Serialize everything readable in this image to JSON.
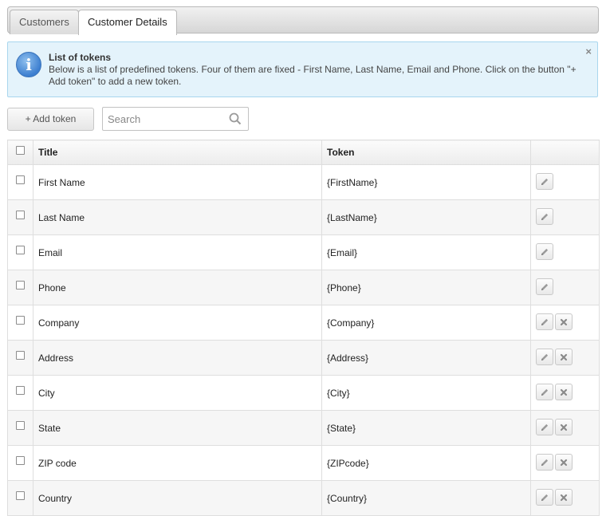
{
  "tabs": [
    {
      "label": "Customers",
      "active": false
    },
    {
      "label": "Customer Details",
      "active": true
    }
  ],
  "info": {
    "title": "List of tokens",
    "text": "Below is a list of predefined tokens. Four of them are fixed - First Name, Last Name, Email and Phone. Click on the button \"+ Add token\" to add a new token.",
    "close": "×"
  },
  "toolbar": {
    "add_label": "+ Add token",
    "search_placeholder": "Search",
    "search_value": ""
  },
  "table": {
    "headers": {
      "title": "Title",
      "token": "Token"
    },
    "rows": [
      {
        "title": "First Name",
        "token": "{FirstName}",
        "deletable": false
      },
      {
        "title": "Last Name",
        "token": "{LastName}",
        "deletable": false
      },
      {
        "title": "Email",
        "token": "{Email}",
        "deletable": false
      },
      {
        "title": "Phone",
        "token": "{Phone}",
        "deletable": false
      },
      {
        "title": "Company",
        "token": "{Company}",
        "deletable": true
      },
      {
        "title": "Address",
        "token": "{Address}",
        "deletable": true
      },
      {
        "title": "City",
        "token": "{City}",
        "deletable": true
      },
      {
        "title": "State",
        "token": "{State}",
        "deletable": true
      },
      {
        "title": "ZIP code",
        "token": "{ZIPcode}",
        "deletable": true
      },
      {
        "title": "Country",
        "token": "{Country}",
        "deletable": true
      }
    ]
  },
  "icons": {
    "info": "info-icon",
    "search": "search-icon",
    "edit": "pencil-icon",
    "delete": "x-icon"
  },
  "colors": {
    "info_bg": "#e4f3fb",
    "info_border": "#a9d6ee",
    "info_icon": "#3d7fd0"
  }
}
